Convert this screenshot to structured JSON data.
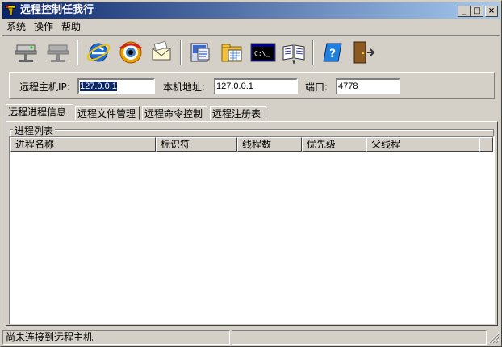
{
  "window": {
    "title": "远程控制任我行"
  },
  "title_buttons": {
    "minimize": "_",
    "maximize": "□",
    "close": "×"
  },
  "menu": [
    "系统",
    "操作",
    "帮助"
  ],
  "toolbar": {
    "icons": [
      "connect-network-icon",
      "disconnect-network-icon",
      "internet-explorer-icon",
      "eye-monitor-icon",
      "email-icon",
      "system-info-icon",
      "file-manager-icon",
      "command-prompt-icon",
      "registry-icon",
      "help-icon",
      "exit-door-icon"
    ],
    "cmd_text": "C:\\_"
  },
  "connection": {
    "remote_host_label": "远程主机IP:",
    "remote_host_value": "127.0.0.1",
    "local_addr_label": "本机地址:",
    "local_addr_value": "127.0.0.1",
    "port_label": "端口:",
    "port_value": "4778"
  },
  "tabs": [
    "远程进程信息",
    "远程文件管理",
    "远程命令控制",
    "远程注册表"
  ],
  "active_tab": 0,
  "group_title": "进程列表",
  "columns": [
    "进程名称",
    "标识符",
    "线程数",
    "优先级",
    "父线程"
  ],
  "statusbar": {
    "text": "尚未连接到远程主机",
    "panel2": ""
  },
  "colors": {
    "titlebar_start": "#0a246a",
    "titlebar_end": "#a6caf0",
    "face": "#d4d0c8"
  }
}
